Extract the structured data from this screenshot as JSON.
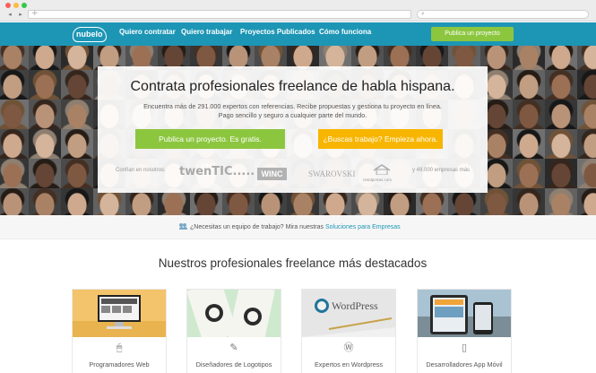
{
  "browser": {
    "traffic_lights": [
      "#fc605c",
      "#fdbc40",
      "#34c84a"
    ],
    "nav_back": "◂",
    "nav_forward": "▸",
    "new_tab": "+",
    "search_glyph": "⌕"
  },
  "header": {
    "logo": "nubelo",
    "nav": [
      "Quiero contratar",
      "Quiero trabajar",
      "Proyectos Publicados",
      "Cómo funciona"
    ],
    "cta": "Publica un proyecto"
  },
  "hero": {
    "title": "Contrata profesionales freelance de habla hispana.",
    "subtitle_line1": "Encuentra más de 291.000 expertos con referencias. Recibe propuestas y gestiona tu proyecto en línea.",
    "subtitle_line2": "Pago sencillo y seguro a cualquier parte del mundo.",
    "primary_button": "Publica un proyecto. Es gratis.",
    "secondary_button": "¿Buscas trabajo? Empieza ahora.",
    "trust_label": "Confían en nosotros:",
    "brands": [
      "twenTIC.....",
      "WINC",
      "SWAROVSKI",
      "residpertas.com"
    ],
    "trust_more": "y 49.000 empresas más"
  },
  "teams_banner": {
    "text": "¿Necesitas un equipo de trabajo? Mira nuestras",
    "link": "Soluciones para Empresas"
  },
  "featured": {
    "title": "Nuestros profesionales freelance más destacados",
    "cards": [
      {
        "label": "Programadores Web",
        "icon": "mouse-icon",
        "glyph": "🖱"
      },
      {
        "label": "Diseñadores de Logotipos",
        "icon": "brush-icon",
        "glyph": "✎"
      },
      {
        "label": "Expertos en Wordpress",
        "icon": "wordpress-icon",
        "glyph": "Ⓦ"
      },
      {
        "label": "Desarrolladores App Móvil",
        "icon": "mobile-icon",
        "glyph": "▯"
      }
    ],
    "card_images": {
      "wordpress_text": "WordPress"
    }
  },
  "colors": {
    "brand_blue": "#1d96b5",
    "green": "#8cc63f",
    "yellow": "#f7b500"
  }
}
